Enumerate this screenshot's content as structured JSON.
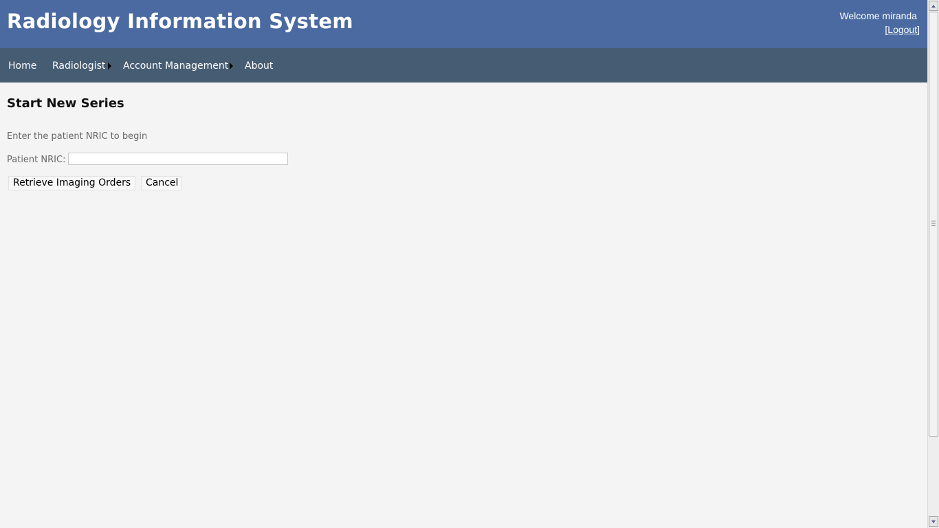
{
  "app": {
    "title": "Radiology Information System",
    "welcome_text": "Welcome miranda",
    "logout_open_bracket": "[",
    "logout_label": "Logout",
    "logout_close_bracket": "]"
  },
  "nav": {
    "items": [
      {
        "label": "Home",
        "has_submenu": false
      },
      {
        "label": "Radiologist",
        "has_submenu": true
      },
      {
        "label": "Account Management",
        "has_submenu": true
      },
      {
        "label": "About",
        "has_submenu": false
      }
    ],
    "submenu_icon": "triangle-right-icon"
  },
  "main": {
    "title": "Start New Series",
    "instruction": "Enter the patient NRIC to begin",
    "nric_label": "Patient NRIC:",
    "nric_value": "",
    "nric_placeholder": "",
    "retrieve_button": "Retrieve Imaging Orders",
    "cancel_button": "Cancel"
  },
  "colors": {
    "header_bg": "#4a6aa1",
    "navbar_bg": "#465c72",
    "content_bg": "#f4f4f4"
  }
}
